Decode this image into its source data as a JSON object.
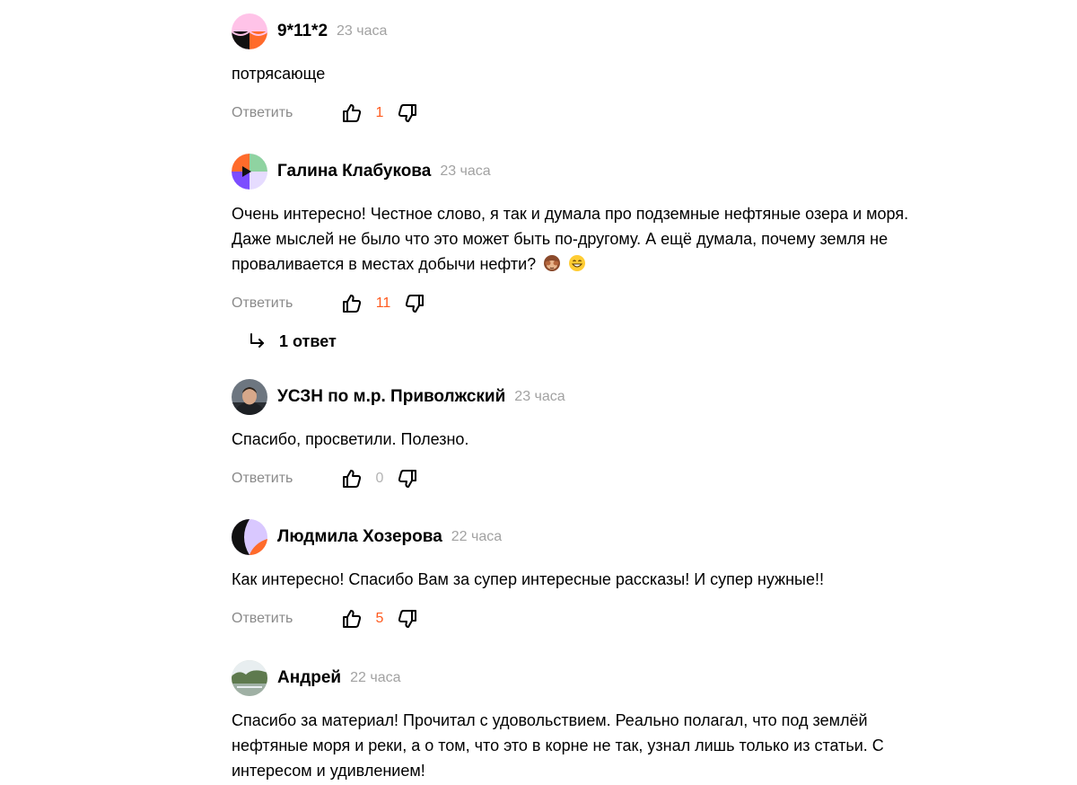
{
  "comments": [
    {
      "author": "9*11*2",
      "time": "23 часа",
      "text": "потрясающе",
      "reply_label": "Ответить",
      "likes": "1"
    },
    {
      "author": "Галина Клабукова",
      "time": "23 часа",
      "text": "Очень интересно! Честное слово, я так и думала про подземные нефтяные озера и моря. Даже мыслей не было что это может быть по-другому. А ещё думала, почему земля не проваливается в местах добычи нефти?",
      "emojis": [
        "see-no-evil-monkey-emoji",
        "grinning-face-emoji"
      ],
      "reply_label": "Ответить",
      "likes": "11",
      "replies_label": "1 ответ"
    },
    {
      "author": "УСЗН по м.р. Приволжский",
      "time": "23 часа",
      "text": "Спасибо, просветили. Полезно.",
      "reply_label": "Ответить",
      "likes": "0"
    },
    {
      "author": "Людмила Хозерова",
      "time": "22 часа",
      "text": "Как интересно! Спасибо Вам за супер интересные рассказы! И супер нужные!!",
      "reply_label": "Ответить",
      "likes": "5"
    },
    {
      "author": "Андрей",
      "time": "22 часа",
      "text": "Спасибо за материал! Прочитал с удовольствием. Реально полагал, что под землёй нефтяные моря и реки, а о том, что это в корне не так, узнал лишь только из статьи. С интересом и удивлением!"
    }
  ],
  "colors": {
    "like_count_positive": "#ff5a1e",
    "like_count_zero": "#b3b3b3",
    "time_text": "#a2a2a2",
    "reply_text": "#8a8a8a"
  },
  "icons": {
    "like": "thumbs-up-icon",
    "dislike": "thumbs-down-icon",
    "replies": "reply-arrow-icon"
  }
}
